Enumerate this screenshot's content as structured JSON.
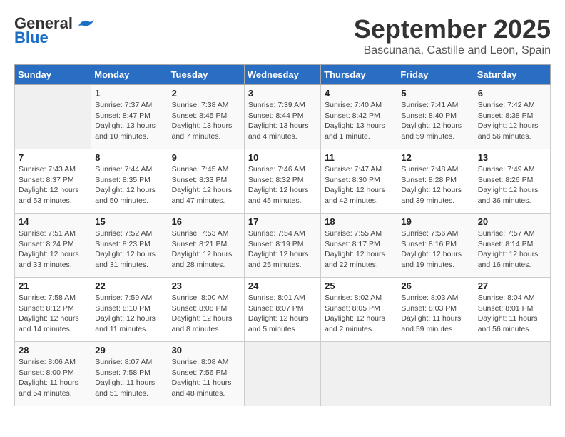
{
  "header": {
    "logo_general": "General",
    "logo_blue": "Blue",
    "month": "September 2025",
    "location": "Bascunana, Castille and Leon, Spain"
  },
  "weekdays": [
    "Sunday",
    "Monday",
    "Tuesday",
    "Wednesday",
    "Thursday",
    "Friday",
    "Saturday"
  ],
  "days": [
    {
      "num": "",
      "info": ""
    },
    {
      "num": "1",
      "info": "Sunrise: 7:37 AM\nSunset: 8:47 PM\nDaylight: 13 hours\nand 10 minutes."
    },
    {
      "num": "2",
      "info": "Sunrise: 7:38 AM\nSunset: 8:45 PM\nDaylight: 13 hours\nand 7 minutes."
    },
    {
      "num": "3",
      "info": "Sunrise: 7:39 AM\nSunset: 8:44 PM\nDaylight: 13 hours\nand 4 minutes."
    },
    {
      "num": "4",
      "info": "Sunrise: 7:40 AM\nSunset: 8:42 PM\nDaylight: 13 hours\nand 1 minute."
    },
    {
      "num": "5",
      "info": "Sunrise: 7:41 AM\nSunset: 8:40 PM\nDaylight: 12 hours\nand 59 minutes."
    },
    {
      "num": "6",
      "info": "Sunrise: 7:42 AM\nSunset: 8:38 PM\nDaylight: 12 hours\nand 56 minutes."
    },
    {
      "num": "7",
      "info": "Sunrise: 7:43 AM\nSunset: 8:37 PM\nDaylight: 12 hours\nand 53 minutes."
    },
    {
      "num": "8",
      "info": "Sunrise: 7:44 AM\nSunset: 8:35 PM\nDaylight: 12 hours\nand 50 minutes."
    },
    {
      "num": "9",
      "info": "Sunrise: 7:45 AM\nSunset: 8:33 PM\nDaylight: 12 hours\nand 47 minutes."
    },
    {
      "num": "10",
      "info": "Sunrise: 7:46 AM\nSunset: 8:32 PM\nDaylight: 12 hours\nand 45 minutes."
    },
    {
      "num": "11",
      "info": "Sunrise: 7:47 AM\nSunset: 8:30 PM\nDaylight: 12 hours\nand 42 minutes."
    },
    {
      "num": "12",
      "info": "Sunrise: 7:48 AM\nSunset: 8:28 PM\nDaylight: 12 hours\nand 39 minutes."
    },
    {
      "num": "13",
      "info": "Sunrise: 7:49 AM\nSunset: 8:26 PM\nDaylight: 12 hours\nand 36 minutes."
    },
    {
      "num": "14",
      "info": "Sunrise: 7:51 AM\nSunset: 8:24 PM\nDaylight: 12 hours\nand 33 minutes."
    },
    {
      "num": "15",
      "info": "Sunrise: 7:52 AM\nSunset: 8:23 PM\nDaylight: 12 hours\nand 31 minutes."
    },
    {
      "num": "16",
      "info": "Sunrise: 7:53 AM\nSunset: 8:21 PM\nDaylight: 12 hours\nand 28 minutes."
    },
    {
      "num": "17",
      "info": "Sunrise: 7:54 AM\nSunset: 8:19 PM\nDaylight: 12 hours\nand 25 minutes."
    },
    {
      "num": "18",
      "info": "Sunrise: 7:55 AM\nSunset: 8:17 PM\nDaylight: 12 hours\nand 22 minutes."
    },
    {
      "num": "19",
      "info": "Sunrise: 7:56 AM\nSunset: 8:16 PM\nDaylight: 12 hours\nand 19 minutes."
    },
    {
      "num": "20",
      "info": "Sunrise: 7:57 AM\nSunset: 8:14 PM\nDaylight: 12 hours\nand 16 minutes."
    },
    {
      "num": "21",
      "info": "Sunrise: 7:58 AM\nSunset: 8:12 PM\nDaylight: 12 hours\nand 14 minutes."
    },
    {
      "num": "22",
      "info": "Sunrise: 7:59 AM\nSunset: 8:10 PM\nDaylight: 12 hours\nand 11 minutes."
    },
    {
      "num": "23",
      "info": "Sunrise: 8:00 AM\nSunset: 8:08 PM\nDaylight: 12 hours\nand 8 minutes."
    },
    {
      "num": "24",
      "info": "Sunrise: 8:01 AM\nSunset: 8:07 PM\nDaylight: 12 hours\nand 5 minutes."
    },
    {
      "num": "25",
      "info": "Sunrise: 8:02 AM\nSunset: 8:05 PM\nDaylight: 12 hours\nand 2 minutes."
    },
    {
      "num": "26",
      "info": "Sunrise: 8:03 AM\nSunset: 8:03 PM\nDaylight: 11 hours\nand 59 minutes."
    },
    {
      "num": "27",
      "info": "Sunrise: 8:04 AM\nSunset: 8:01 PM\nDaylight: 11 hours\nand 56 minutes."
    },
    {
      "num": "28",
      "info": "Sunrise: 8:06 AM\nSunset: 8:00 PM\nDaylight: 11 hours\nand 54 minutes."
    },
    {
      "num": "29",
      "info": "Sunrise: 8:07 AM\nSunset: 7:58 PM\nDaylight: 11 hours\nand 51 minutes."
    },
    {
      "num": "30",
      "info": "Sunrise: 8:08 AM\nSunset: 7:56 PM\nDaylight: 11 hours\nand 48 minutes."
    },
    {
      "num": "",
      "info": ""
    },
    {
      "num": "",
      "info": ""
    },
    {
      "num": "",
      "info": ""
    },
    {
      "num": "",
      "info": ""
    }
  ]
}
